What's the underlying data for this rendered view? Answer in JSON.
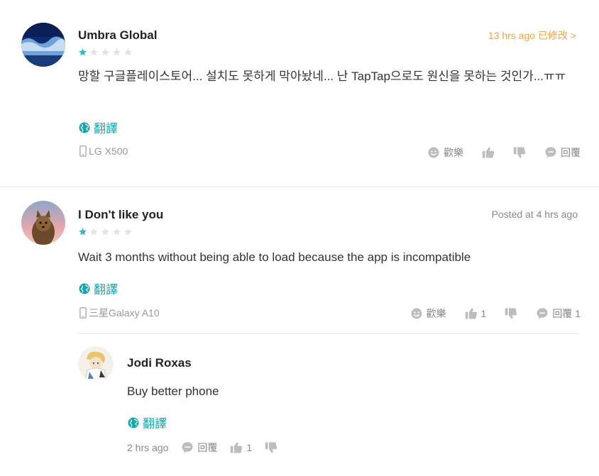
{
  "reviews": [
    {
      "author": "Umbra Global",
      "rating": 1,
      "time": "13 hrs ago 已修改 >",
      "body": "망할 구글플레이스토어... 설치도 못하게 막아놨네... 난 TapTap으로도 원신을 못하는 것인가...ㅠㅠ",
      "translate": "翻譯",
      "device": "LG X500",
      "actions": {
        "happy": "歡樂",
        "reply": "回覆"
      }
    },
    {
      "author": "I Don't like you",
      "rating": 1,
      "time": "Posted at 4 hrs ago",
      "body": "Wait 3 months without being able to load because the app is incompatible",
      "translate": "翻譯",
      "device": "三星Galaxy A10",
      "actions": {
        "happy": "歡樂",
        "like_count": "1",
        "reply": "回覆 1"
      },
      "reply": {
        "author": "Jodi Roxas",
        "body": "Buy better phone",
        "translate": "翻譯",
        "time": "2 hrs ago",
        "reply_label": "回覆",
        "like_count": "1"
      }
    }
  ],
  "colors": {
    "accent": "#14a8ac",
    "star": "#34b4c6",
    "star_empty": "#e3e3e3",
    "edited": "#f0a34a"
  }
}
